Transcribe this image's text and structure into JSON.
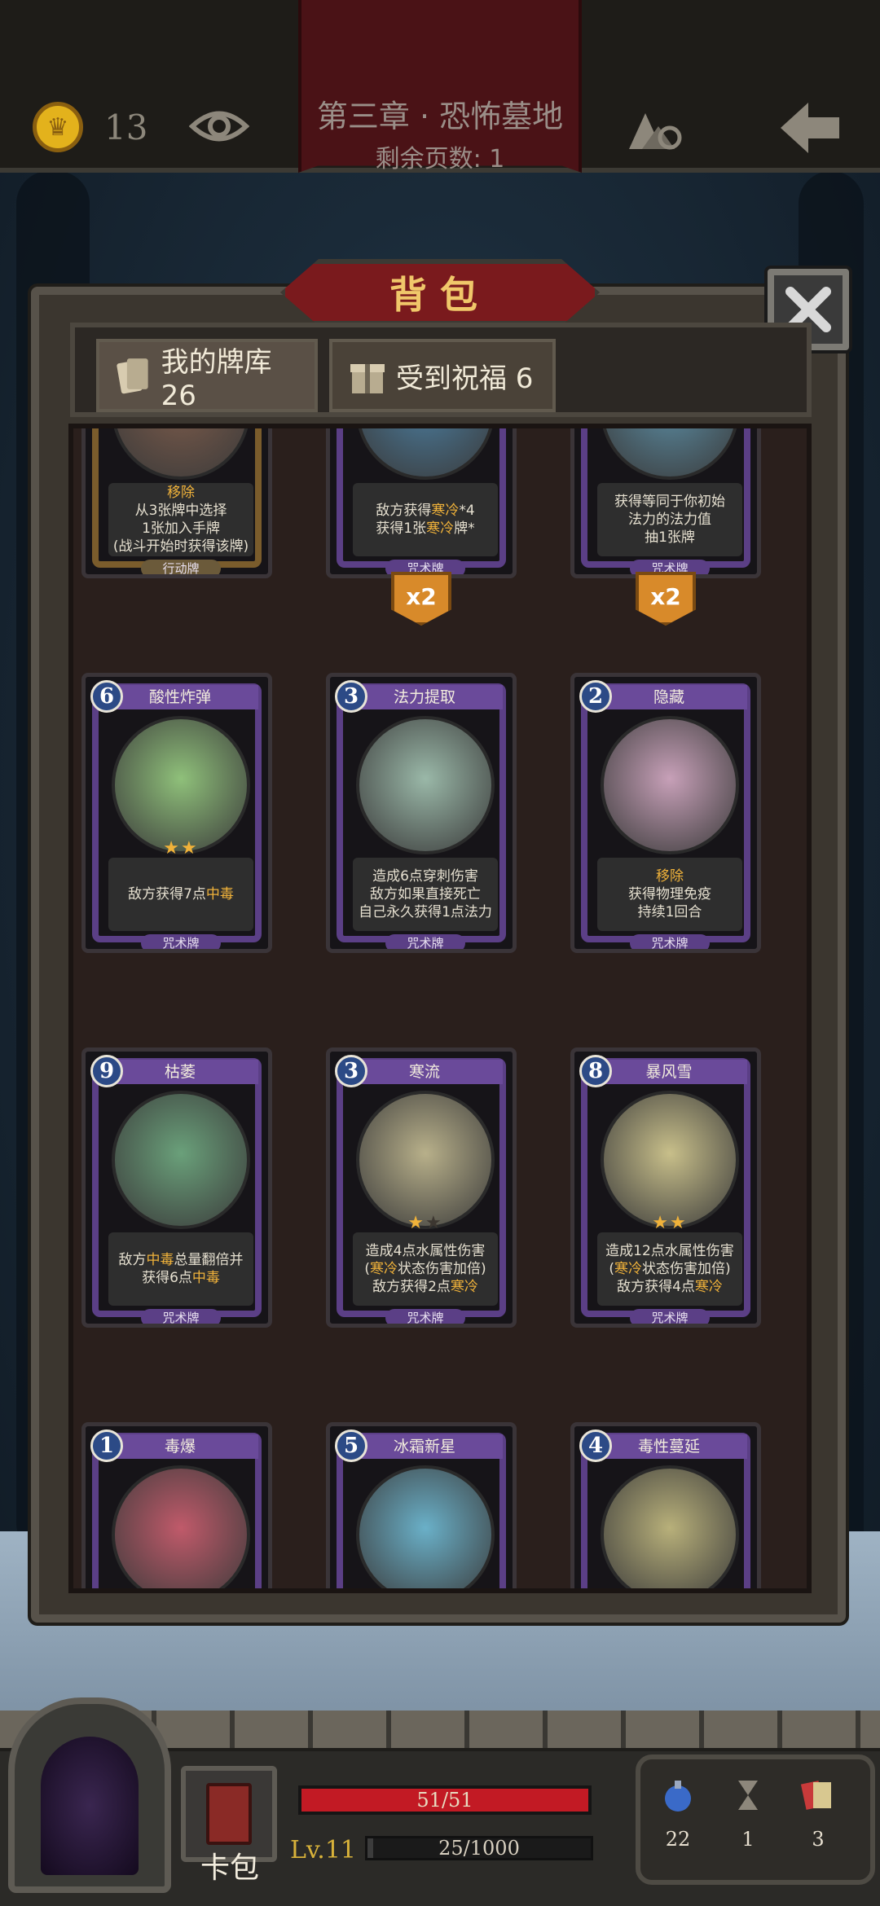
{
  "topbar": {
    "coins": "13",
    "chapter_title": "第三章 · 恐怖墓地",
    "pages_left": "剩余页数: 1"
  },
  "bag": {
    "title": "背包",
    "tabs": [
      {
        "label": "我的牌库 26",
        "active": true
      },
      {
        "label": "受到祝福 6",
        "active": false
      }
    ]
  },
  "cards": [
    {
      "name": "",
      "cost": "",
      "type": "行动牌",
      "kind": "action",
      "desc": [
        "移除",
        "从3张牌中选择",
        "1张加入手牌",
        "(战斗开始时获得该牌)"
      ],
      "stars": 0,
      "art_color": "#7a5a4a",
      "multiplier": ""
    },
    {
      "name": "",
      "cost": "",
      "type": "咒术牌",
      "kind": "spell",
      "desc": [
        "敌方获得寒冷*4",
        "获得1张寒冷牌*"
      ],
      "stars": 0,
      "art_color": "#4a7a9a",
      "multiplier": "x2"
    },
    {
      "name": "",
      "cost": "",
      "type": "咒术牌",
      "kind": "spell",
      "desc": [
        "获得等同于你初始",
        "法力的法力值",
        "抽1张牌"
      ],
      "stars": 0,
      "art_color": "#5a8aa0",
      "multiplier": "x2"
    },
    {
      "name": "酸性炸弹",
      "cost": "6",
      "type": "咒术牌",
      "kind": "spell",
      "desc": [
        "敌方获得7点中毒"
      ],
      "stars": 2,
      "max_stars": 2,
      "art_color": "#8fc07a",
      "multiplier": ""
    },
    {
      "name": "法力提取",
      "cost": "3",
      "type": "咒术牌",
      "kind": "spell",
      "desc": [
        "造成6点穿刺伤害",
        "敌方如果直接死亡",
        "自己永久获得1点法力"
      ],
      "stars": 0,
      "art_color": "#9ab8a8",
      "multiplier": ""
    },
    {
      "name": "隐藏",
      "cost": "2",
      "type": "咒术牌",
      "kind": "spell",
      "desc": [
        "移除",
        "获得物理免疫",
        "持续1回合"
      ],
      "stars": 0,
      "art_color": "#c7a0b8",
      "multiplier": ""
    },
    {
      "name": "枯萎",
      "cost": "9",
      "type": "咒术牌",
      "kind": "spell",
      "desc": [
        "敌方中毒总量翻倍并",
        "获得6点中毒"
      ],
      "stars": 0,
      "art_color": "#6aa07a",
      "multiplier": ""
    },
    {
      "name": "寒流",
      "cost": "3",
      "type": "咒术牌",
      "kind": "spell",
      "desc": [
        "造成4点水属性伤害",
        "(寒冷状态伤害加倍)",
        "敌方获得2点寒冷"
      ],
      "stars": 1,
      "max_stars": 2,
      "art_color": "#b8b08a",
      "multiplier": ""
    },
    {
      "name": "暴风雪",
      "cost": "8",
      "type": "咒术牌",
      "kind": "spell",
      "desc": [
        "造成12点水属性伤害",
        "(寒冷状态伤害加倍)",
        "敌方获得4点寒冷"
      ],
      "stars": 2,
      "max_stars": 2,
      "art_color": "#c8bf8a",
      "multiplier": ""
    },
    {
      "name": "毒爆",
      "cost": "1",
      "type": "",
      "kind": "spell",
      "desc": [],
      "stars": 0,
      "art_color": "#c05a6a",
      "multiplier": ""
    },
    {
      "name": "冰霜新星",
      "cost": "5",
      "type": "",
      "kind": "spell",
      "desc": [],
      "stars": 0,
      "art_color": "#6ab0c8",
      "multiplier": ""
    },
    {
      "name": "毒性蔓延",
      "cost": "4",
      "type": "",
      "kind": "spell",
      "desc": [],
      "stars": 0,
      "art_color": "#b8b07a",
      "multiplier": ""
    }
  ],
  "highlight_words": [
    "移除",
    "寒冷",
    "中毒"
  ],
  "hud": {
    "deck_label": "卡包",
    "hp": "51/51",
    "hp_fraction": 1.0,
    "level": "Lv.11",
    "xp": "25/1000",
    "xp_fraction": 0.025,
    "potions": "22",
    "hourglass": "1",
    "cards": "3"
  },
  "colors": {
    "accent_gold": "#f0b23a",
    "spell_purple": "#5b3f86",
    "hp_red": "#c21a24"
  }
}
